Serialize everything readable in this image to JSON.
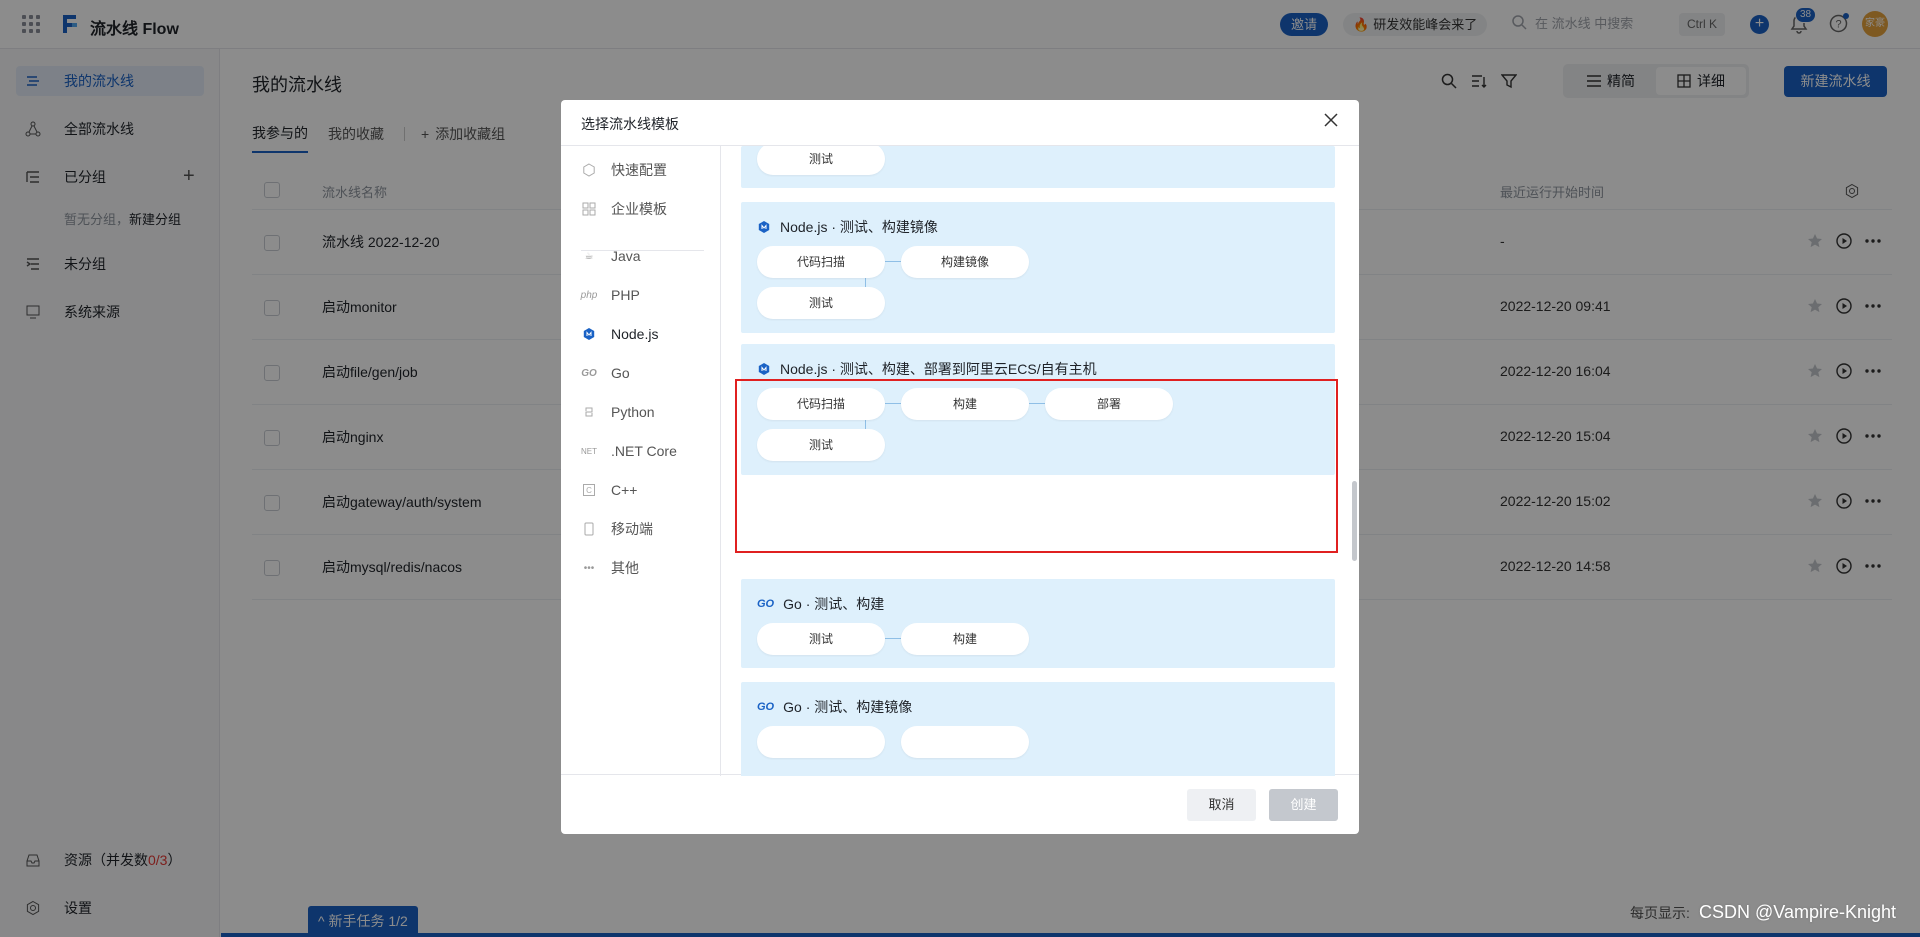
{
  "topbar": {
    "brand": "流水线 Flow",
    "invite": "邀请",
    "promo": "研发效能峰会来了",
    "search_placeholder": "在 流水线 中搜索",
    "shortcut": "Ctrl K",
    "notifications": "38",
    "avatar": "家豪"
  },
  "sidebar": {
    "items": [
      {
        "label": "我的流水线"
      },
      {
        "label": "全部流水线"
      },
      {
        "label": "已分组"
      },
      {
        "label": "未分组"
      },
      {
        "label": "系统来源"
      }
    ],
    "empty_group": "暂无分组，",
    "new_group": "新建分组",
    "resource_label": "资源（并发数",
    "resource_value": "0/3",
    "resource_close": "）",
    "settings": "设置"
  },
  "main": {
    "title": "我的流水线",
    "view_compact": "精简",
    "view_detail": "详细",
    "new_pipeline": "新建流水线",
    "tabs": [
      "我参与的",
      "我的收藏"
    ],
    "add_favorite_group": "添加收藏组",
    "columns": {
      "name": "流水线名称",
      "last_run": "最近运行开始时间"
    },
    "rows": [
      {
        "name": "流水线 2022-12-20",
        "time": "-"
      },
      {
        "name": "启动monitor",
        "time": "2022-12-20 09:41"
      },
      {
        "name": "启动file/gen/job",
        "time": "2022-12-20 16:04"
      },
      {
        "name": "启动nginx",
        "time": "2022-12-20 15:04"
      },
      {
        "name": "启动gateway/auth/system",
        "time": "2022-12-20 15:02"
      },
      {
        "name": "启动mysql/redis/nacos",
        "time": "2022-12-20 14:58"
      }
    ],
    "page_size_label": "每页显示:",
    "newbie_task": "新手任务 1/2",
    "watermark": "CSDN @Vampire-Knight"
  },
  "modal": {
    "title": "选择流水线模板",
    "categories": [
      "快速配置",
      "企业模板",
      "Java",
      "PHP",
      "Node.js",
      "Go",
      "Python",
      ".NET Core",
      "C++",
      "移动端",
      "其他"
    ],
    "templates": [
      {
        "title": "",
        "stages": [
          "测试"
        ]
      },
      {
        "title": "Node.js · 测试、构建镜像",
        "stages": [
          "代码扫描",
          "构建镜像",
          "测试"
        ]
      },
      {
        "title": "Node.js · 测试、构建、部署到阿里云ECS/自有主机",
        "stages": [
          "代码扫描",
          "构建",
          "部署",
          "测试"
        ]
      },
      {
        "title": "Go · 测试、构建",
        "stages": [
          "测试",
          "构建"
        ]
      },
      {
        "title": "Go · 测试、构建镜像",
        "stages": []
      }
    ],
    "cancel": "取消",
    "create": "创建"
  },
  "colors": {
    "accent": "#1a62c5",
    "template_bg": "#def0fc",
    "highlight": "#e02020"
  }
}
